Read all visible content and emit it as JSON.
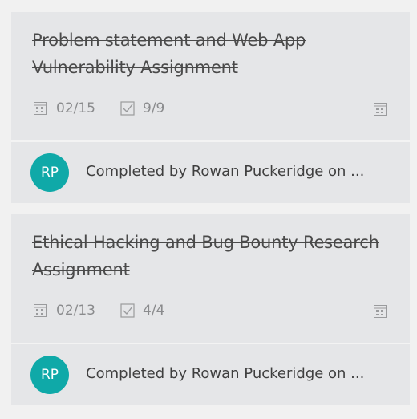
{
  "cards": [
    {
      "title": "Problem statement and Web App Vulnerability Assignment",
      "due_date": "02/15",
      "checklist": "9/9",
      "assignee_initials": "RP",
      "completed_text": "Completed by Rowan Puckeridge on ..."
    },
    {
      "title": "Ethical Hacking and Bug Bounty Research Assignment",
      "due_date": "02/13",
      "checklist": "4/4",
      "assignee_initials": "RP",
      "completed_text": "Completed by Rowan Puckeridge on ..."
    }
  ],
  "icons": {
    "due_date": "calendar-icon",
    "checklist": "checkbox-icon",
    "right": "calendar-icon"
  },
  "colors": {
    "card_background": "#e5e6e8",
    "page_background": "#f1f1f1",
    "avatar": "#0fa9a8",
    "meta_text": "#8a8b8d"
  }
}
